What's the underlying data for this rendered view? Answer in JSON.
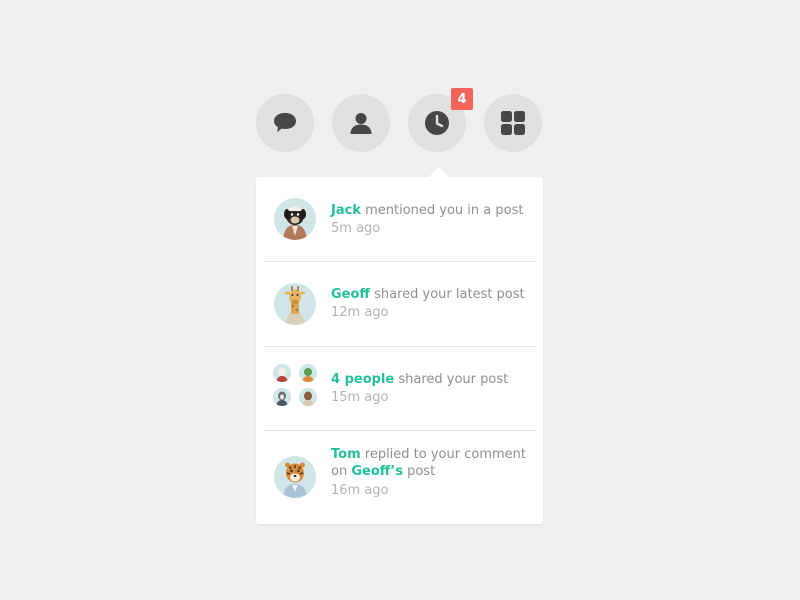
{
  "nav": {
    "items": [
      {
        "name": "messages",
        "icon": "speech-bubble-icon"
      },
      {
        "name": "profile",
        "icon": "user-icon"
      },
      {
        "name": "activity",
        "icon": "clock-icon"
      },
      {
        "name": "apps",
        "icon": "grid-icon"
      }
    ],
    "badge_count": "4"
  },
  "notifications": [
    {
      "actor": "Jack",
      "text": " mentioned you in a post",
      "time": "5m ago",
      "avatar_icon": "dog-avatar-icon"
    },
    {
      "actor": "Geoff",
      "text": " shared your latest post",
      "time": "12m ago",
      "avatar_icon": "giraffe-avatar-icon"
    },
    {
      "actor": "4 people",
      "text": " shared your post",
      "time": "15m ago",
      "avatar_icon": "group-avatars-icon"
    },
    {
      "actor": "Tom",
      "text": " replied to your comment on ",
      "target": "Geoff’s",
      "text_after": " post",
      "time": "16m ago",
      "avatar_icon": "tiger-avatar-icon"
    }
  ],
  "colors": {
    "accent": "#22bf9b",
    "badge": "#f06459",
    "background": "#efefef",
    "icon": "#474747"
  }
}
